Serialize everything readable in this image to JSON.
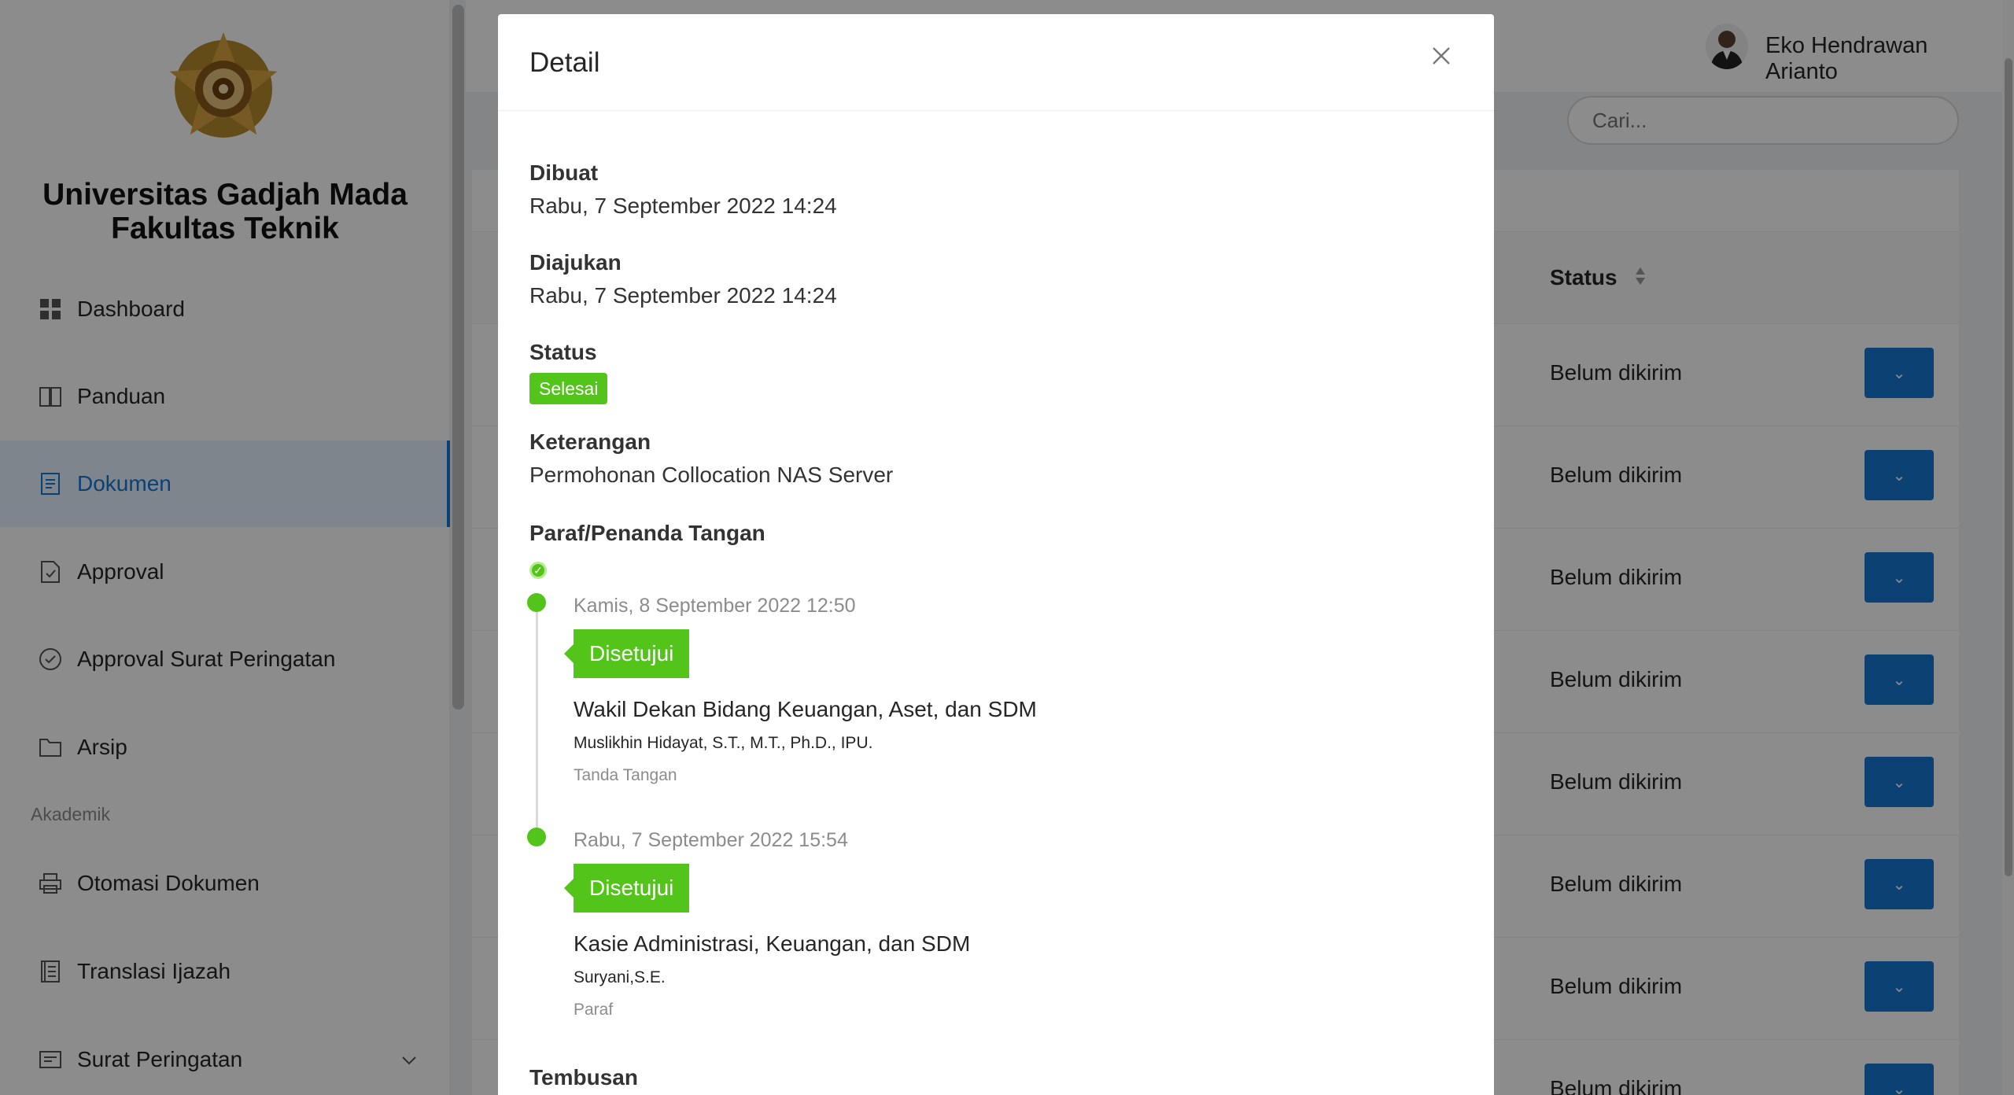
{
  "sidebar": {
    "university": "Universitas Gadjah Mada",
    "faculty": "Fakultas Teknik",
    "items": [
      {
        "label": "Dashboard",
        "icon": "dashboard-icon"
      },
      {
        "label": "Panduan",
        "icon": "book-icon"
      },
      {
        "label": "Dokumen",
        "icon": "document-icon",
        "active": true
      },
      {
        "label": "Approval",
        "icon": "file-check-icon"
      },
      {
        "label": "Approval Surat Peringatan",
        "icon": "check-circle-icon"
      },
      {
        "label": "Arsip",
        "icon": "folder-icon"
      }
    ],
    "group_label": "Akademik",
    "items2": [
      {
        "label": "Otomasi Dokumen",
        "icon": "printer-icon"
      },
      {
        "label": "Translasi Ijazah",
        "icon": "list-doc-icon"
      },
      {
        "label": "Surat Peringatan",
        "icon": "id-card-icon"
      }
    ]
  },
  "header": {
    "user_name": "Eko Hendrawan Arianto"
  },
  "search": {
    "placeholder": "Cari..."
  },
  "table": {
    "status_header": "Status",
    "rows": [
      {
        "status": "Belum dikirim"
      },
      {
        "status": "Belum dikirim"
      },
      {
        "status": "Belum dikirim"
      },
      {
        "status": "Belum dikirim"
      },
      {
        "status": "Belum dikirim"
      },
      {
        "status": "Belum dikirim"
      },
      {
        "status": "Belum dikirim"
      },
      {
        "status": "Belum dikirim"
      }
    ]
  },
  "modal": {
    "title": "Detail",
    "created_label": "Dibuat",
    "created_value": "Rabu, 7 September 2022 14:24",
    "submitted_label": "Diajukan",
    "submitted_value": "Rabu, 7 September 2022 14:24",
    "status_label": "Status",
    "status_value": "Selesai",
    "note_label": "Keterangan",
    "note_value": "Permohonan Collocation NAS Server",
    "sign_label": "Paraf/Penanda Tangan",
    "timeline": [
      {
        "time": "Kamis, 8 September 2022 12:50",
        "badge": "Disetujui",
        "role": "Wakil Dekan Bidang Keuangan, Aset, dan SDM",
        "name": "Muslikhin Hidayat, S.T., M.T., Ph.D., IPU.",
        "kind": "Tanda Tangan"
      },
      {
        "time": "Rabu, 7 September 2022 15:54",
        "badge": "Disetujui",
        "role": "Kasie Administrasi, Keuangan, dan SDM",
        "name": "Suryani,S.E.",
        "kind": "Paraf"
      }
    ],
    "cc_label": "Tembusan"
  },
  "colors": {
    "primary": "#1677d2",
    "success": "#52c41a",
    "active_bg": "#e6f2ff"
  }
}
